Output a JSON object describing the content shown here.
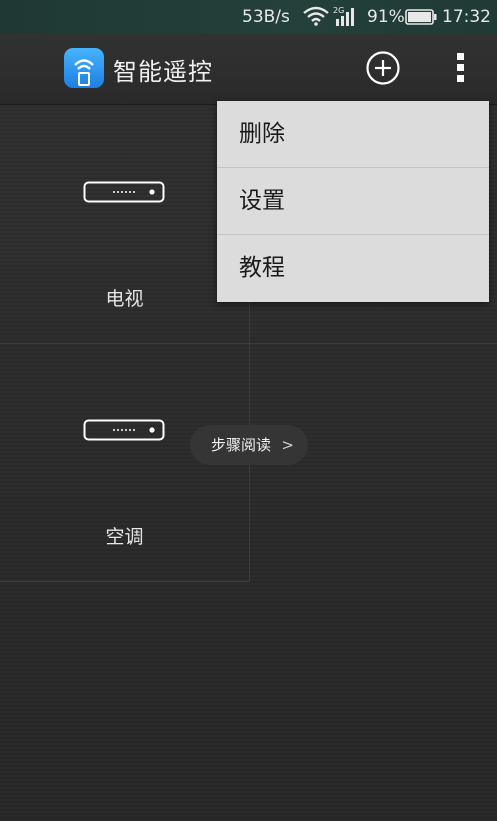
{
  "status_bar": {
    "net_speed": "53B/s",
    "network_type": "2G",
    "battery_percent": "91%",
    "time": "17:32",
    "icons": [
      "wifi-icon",
      "signal-icon",
      "battery-icon"
    ]
  },
  "app_bar": {
    "title": "智能遥控",
    "icons": [
      "app-logo-icon",
      "add-icon",
      "more-icon"
    ]
  },
  "devices": [
    {
      "label": "电视",
      "icon": "remote-device-icon"
    },
    {
      "label": "空调",
      "icon": "remote-device-icon"
    }
  ],
  "step_reading": {
    "label": "步骤阅读",
    "icon": "chevron-right-icon"
  },
  "menu": {
    "items": [
      {
        "label": "删除"
      },
      {
        "label": "设置"
      },
      {
        "label": "教程"
      }
    ]
  },
  "colors": {
    "status_bar": "#203a36",
    "app_bar": "#2e2e2e",
    "app_icon": "#2b8cf0",
    "menu_bg": "#dcdcdc"
  }
}
